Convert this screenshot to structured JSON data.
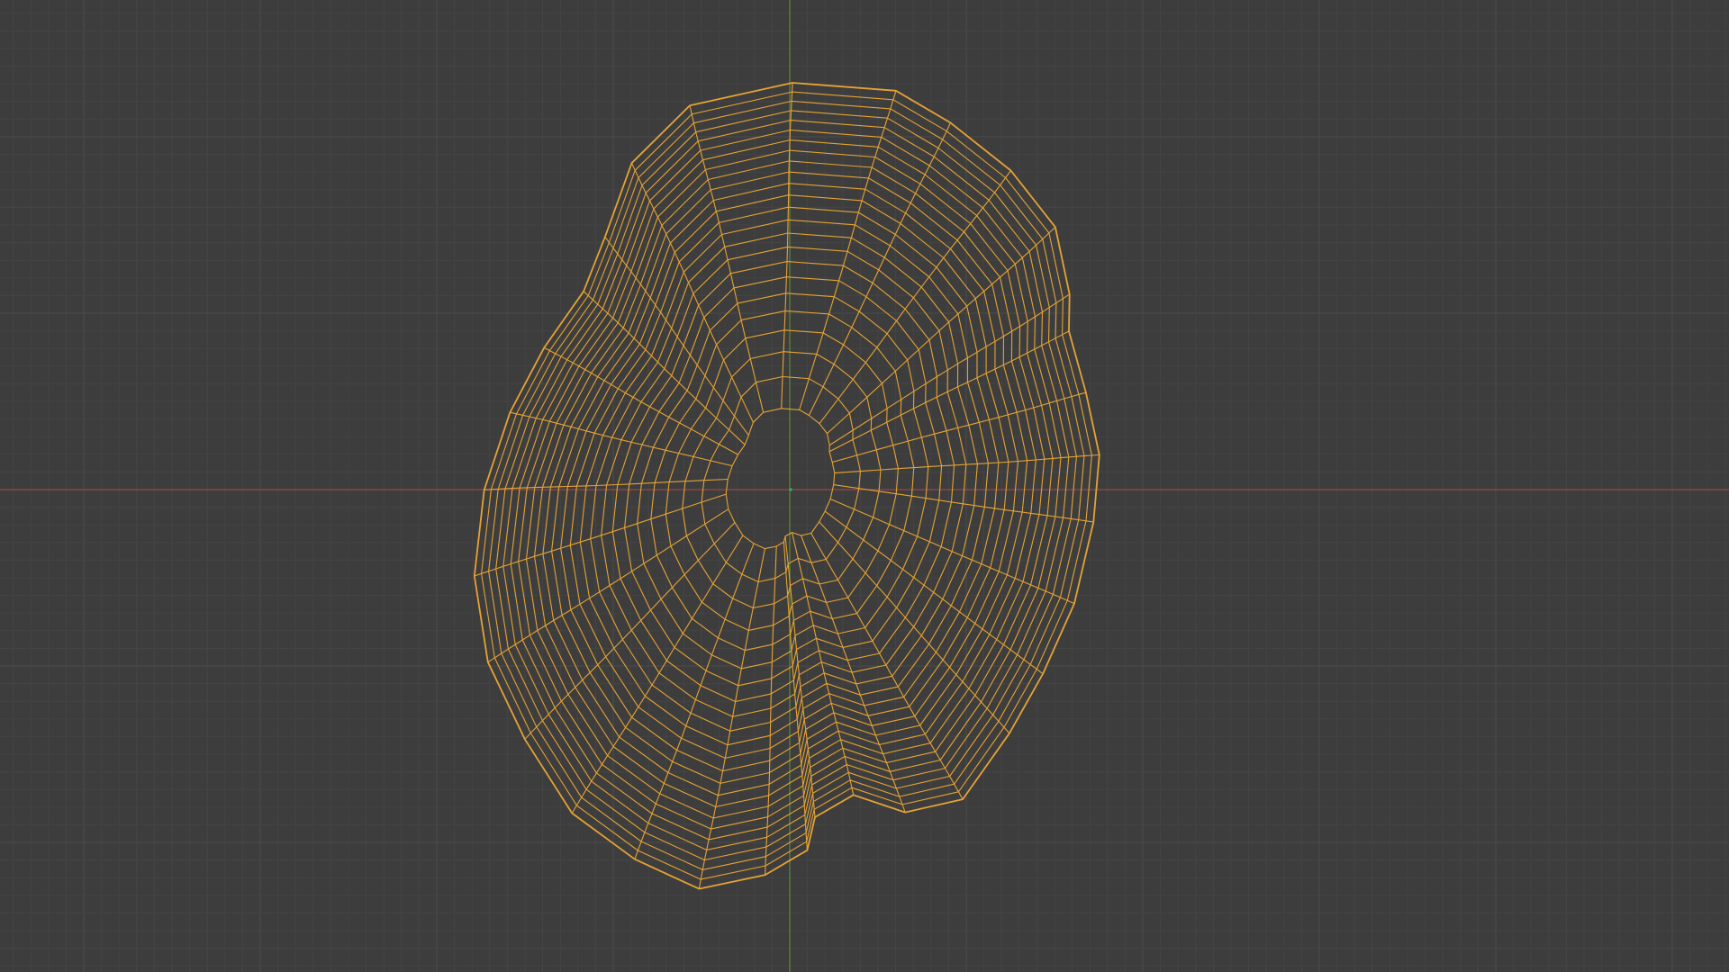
{
  "viewport": {
    "mode": "wireframe",
    "selected_object": true,
    "colors": {
      "background": "#3d3d3d",
      "grid_minor": "#444444",
      "grid_major": "#4a4a4a",
      "axis_x": "#9a4646",
      "axis_y": "#5f8a35",
      "wire": "#e5a335",
      "origin": "#2fae6a"
    },
    "object": {
      "shape": "potato-like blob",
      "rings": 24,
      "segments": 32
    }
  }
}
